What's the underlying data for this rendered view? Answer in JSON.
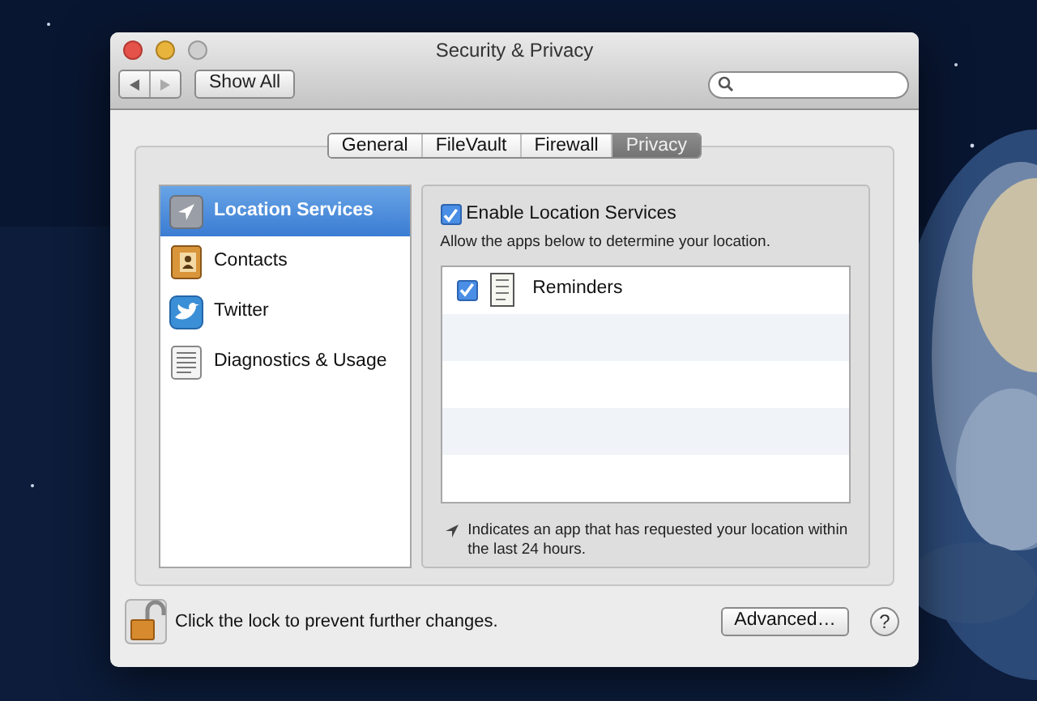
{
  "window": {
    "title": "Security & Privacy"
  },
  "toolbar": {
    "show_all": "Show All"
  },
  "tabs": [
    {
      "label": "General",
      "selected": false
    },
    {
      "label": "FileVault",
      "selected": false
    },
    {
      "label": "Firewall",
      "selected": false
    },
    {
      "label": "Privacy",
      "selected": true
    }
  ],
  "sidebar": {
    "items": [
      {
        "label": "Location Services",
        "kind": "location",
        "selected": true
      },
      {
        "label": "Contacts",
        "kind": "contacts",
        "selected": false
      },
      {
        "label": "Twitter",
        "kind": "twitter",
        "selected": false
      },
      {
        "label": "Diagnostics & Usage",
        "kind": "diagnostics",
        "selected": false
      }
    ]
  },
  "location": {
    "enable": {
      "label": "Enable Location Services",
      "checked": true
    },
    "description": "Allow the apps below to determine your location.",
    "apps": [
      {
        "name": "Reminders",
        "checked": true
      }
    ],
    "footnote": "Indicates an app that has requested your location within the last 24 hours."
  },
  "footer": {
    "lock": {
      "locked": false,
      "text": "Click the lock to prevent further changes."
    },
    "advanced": "Advanced…",
    "help": "?"
  }
}
